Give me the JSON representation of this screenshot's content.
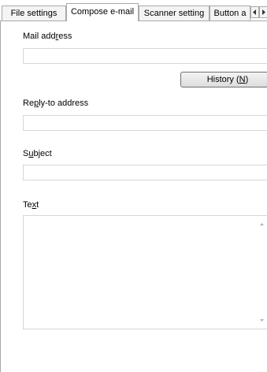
{
  "tabs": [
    {
      "label": "File settings"
    },
    {
      "label": "Compose e-mail"
    },
    {
      "label": "Scanner setting"
    },
    {
      "label": "Button a"
    }
  ],
  "form": {
    "mail_address": {
      "pre": "Mail add",
      "key": "r",
      "post": "ess",
      "value": ""
    },
    "history_button": {
      "pre": "History (",
      "key": "N",
      "post": ")"
    },
    "reply_to": {
      "pre": "Re",
      "key": "p",
      "post": "ly-to address",
      "value": ""
    },
    "subject": {
      "pre": "S",
      "key": "u",
      "post": "bject",
      "value": ""
    },
    "text": {
      "pre": "Te",
      "key": "x",
      "post": "t",
      "value": ""
    }
  },
  "icons": {
    "tab_scroll_left": "triangle-left-icon",
    "textarea_up": "triangle-up-icon",
    "textarea_down": "triangle-down-icon"
  }
}
